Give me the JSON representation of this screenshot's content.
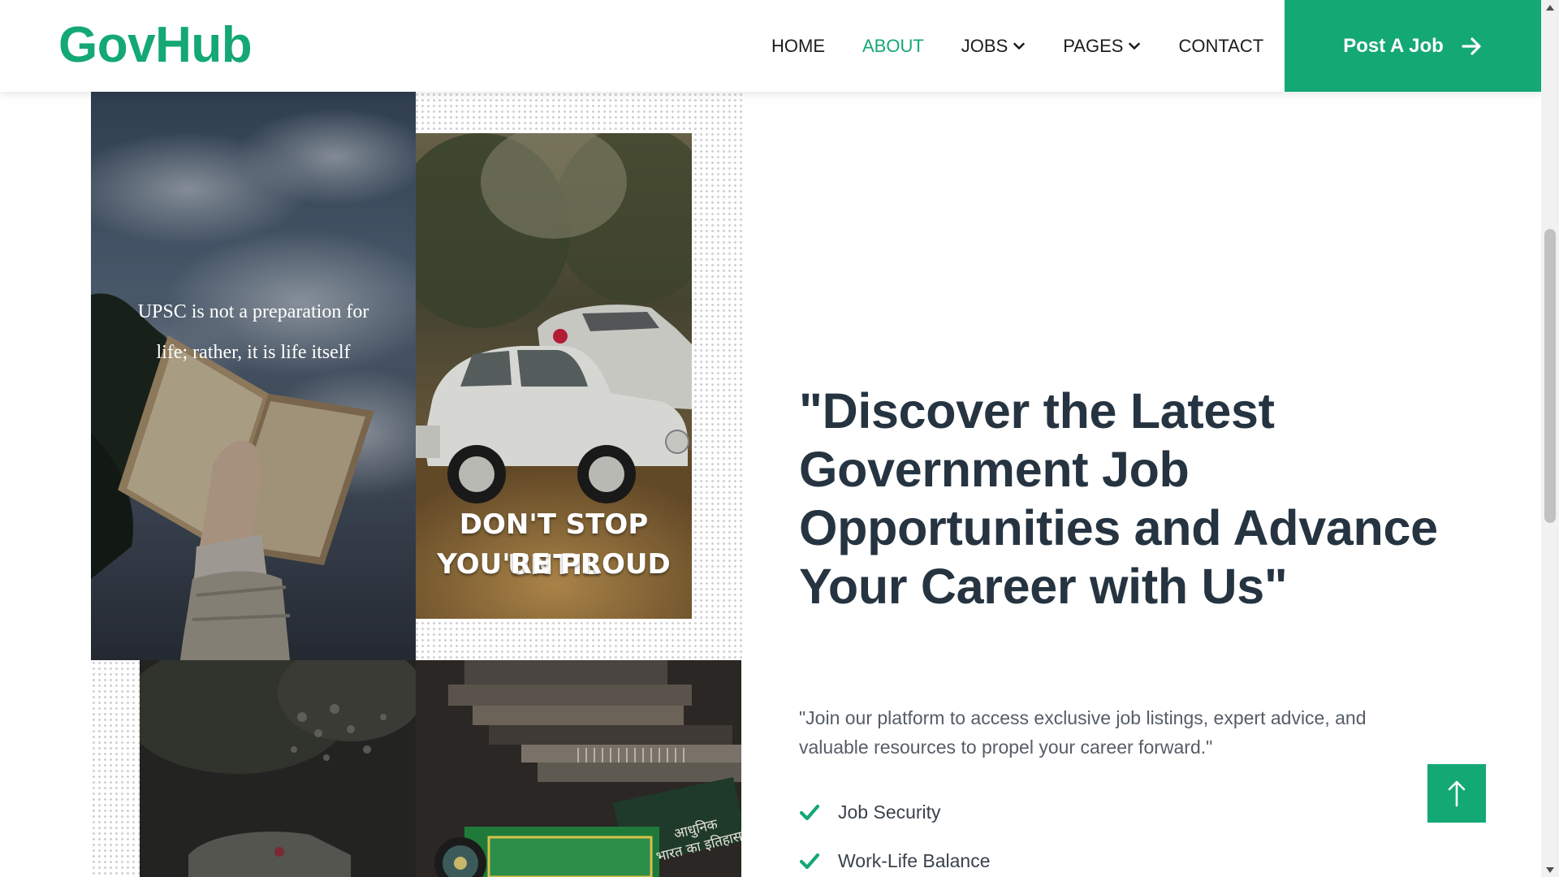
{
  "brand": {
    "name": "GovHub"
  },
  "nav": {
    "items": [
      {
        "label": "HOME",
        "active": false,
        "has_dropdown": false
      },
      {
        "label": "ABOUT",
        "active": true,
        "has_dropdown": false
      },
      {
        "label": "JOBS",
        "active": false,
        "has_dropdown": true
      },
      {
        "label": "PAGES",
        "active": false,
        "has_dropdown": true
      },
      {
        "label": "CONTACT",
        "active": false,
        "has_dropdown": false
      }
    ],
    "cta_label": "Post A Job",
    "cta_icon": "arrow-right-icon"
  },
  "collage": {
    "quote_image_text": "UPSC is not a preparation for life; rather, it is life itself",
    "poster_image_text_line1": "DON'T STOP UNTIL",
    "poster_image_text_line2": "YOU'RE PROUD",
    "book_label_1": "आधुनिक",
    "book_label_2": "भारत का इतिहास"
  },
  "about": {
    "headline": "\"Discover the Latest Government Job Opportunities and Advance Your Career with Us\"",
    "lede": "\"Join our platform to access exclusive job listings, expert advice, and valuable resources to propel your career forward.\"",
    "features": [
      {
        "label": "Job Security",
        "icon": "check-icon"
      },
      {
        "label": "Work-Life Balance",
        "icon": "check-icon"
      }
    ]
  },
  "back_to_top": {
    "icon": "arrow-up-icon"
  },
  "colors": {
    "accent": "#14a874",
    "heading": "#263441",
    "body_text": "#555d66"
  }
}
